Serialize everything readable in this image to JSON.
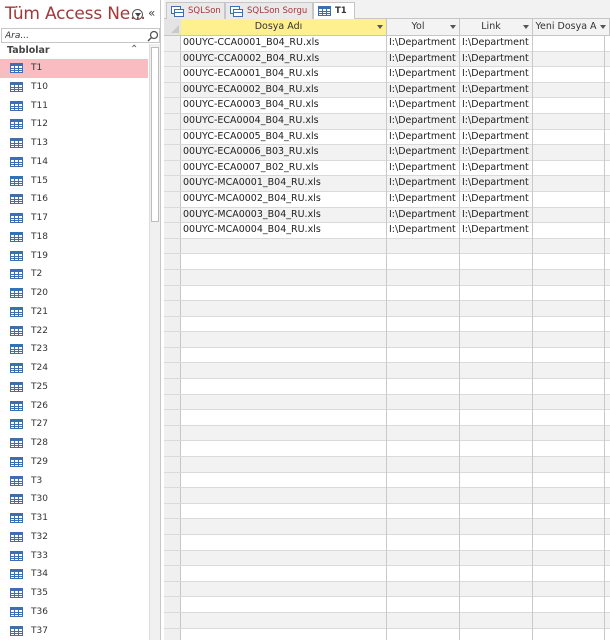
{
  "nav": {
    "title": "Tüm Access Ne...",
    "search_placeholder": "Ara...",
    "section_label": "Tablolar",
    "items": [
      {
        "label": "T1",
        "selected": true
      },
      {
        "label": "T10"
      },
      {
        "label": "T11"
      },
      {
        "label": "T12"
      },
      {
        "label": "T13"
      },
      {
        "label": "T14"
      },
      {
        "label": "T15"
      },
      {
        "label": "T16"
      },
      {
        "label": "T17"
      },
      {
        "label": "T18"
      },
      {
        "label": "T19"
      },
      {
        "label": "T2"
      },
      {
        "label": "T20"
      },
      {
        "label": "T21"
      },
      {
        "label": "T22"
      },
      {
        "label": "T23"
      },
      {
        "label": "T24"
      },
      {
        "label": "T25"
      },
      {
        "label": "T26"
      },
      {
        "label": "T27"
      },
      {
        "label": "T28"
      },
      {
        "label": "T29"
      },
      {
        "label": "T3"
      },
      {
        "label": "T30"
      },
      {
        "label": "T31"
      },
      {
        "label": "T32"
      },
      {
        "label": "T33"
      },
      {
        "label": "T34"
      },
      {
        "label": "T35"
      },
      {
        "label": "T36"
      },
      {
        "label": "T37"
      }
    ]
  },
  "tabs": [
    {
      "label": "SQLSon",
      "icon": "query-icon",
      "active": false
    },
    {
      "label": "SQLSon Sorgu",
      "icon": "query-icon",
      "active": false
    },
    {
      "label": "T1",
      "icon": "table-icon",
      "active": true
    }
  ],
  "grid": {
    "columns": [
      {
        "label": "Dosya Adı",
        "sortable": true,
        "selected": true
      },
      {
        "label": "Yol",
        "sortable": true
      },
      {
        "label": "Link",
        "sortable": true
      },
      {
        "label": "Yeni Dosya A",
        "sortable": true
      }
    ],
    "rows": [
      [
        "00UYC-CCA0001_B04_RU.xls",
        "I:\\Department",
        "I:\\Department",
        ""
      ],
      [
        "00UYC-CCA0002_B04_RU.xls",
        "I:\\Department",
        "I:\\Department",
        ""
      ],
      [
        "00UYC-ECA0001_B04_RU.xls",
        "I:\\Department",
        "I:\\Department",
        ""
      ],
      [
        "00UYC-ECA0002_B04_RU.xls",
        "I:\\Department",
        "I:\\Department",
        ""
      ],
      [
        "00UYC-ECA0003_B04_RU.xls",
        "I:\\Department",
        "I:\\Department",
        ""
      ],
      [
        "00UYC-ECA0004_B04_RU.xls",
        "I:\\Department",
        "I:\\Department",
        ""
      ],
      [
        "00UYC-ECA0005_B04_RU.xls",
        "I:\\Department",
        "I:\\Department",
        ""
      ],
      [
        "00UYC-ECA0006_B03_RU.xls",
        "I:\\Department",
        "I:\\Department",
        ""
      ],
      [
        "00UYC-ECA0007_B02_RU.xls",
        "I:\\Department",
        "I:\\Department",
        ""
      ],
      [
        "00UYC-MCA0001_B04_RU.xls",
        "I:\\Department",
        "I:\\Department",
        ""
      ],
      [
        "00UYC-MCA0002_B04_RU.xls",
        "I:\\Department",
        "I:\\Department",
        ""
      ],
      [
        "00UYC-MCA0003_B04_RU.xls",
        "I:\\Department",
        "I:\\Department",
        ""
      ],
      [
        "00UYC-MCA0004_B04_RU.xls",
        "I:\\Department",
        "I:\\Department",
        ""
      ]
    ],
    "empty_row_count": 26
  },
  "colors": {
    "accent": "#a4373a",
    "selected_nav": "#f8bcc1",
    "selected_header": "#fef08e"
  }
}
